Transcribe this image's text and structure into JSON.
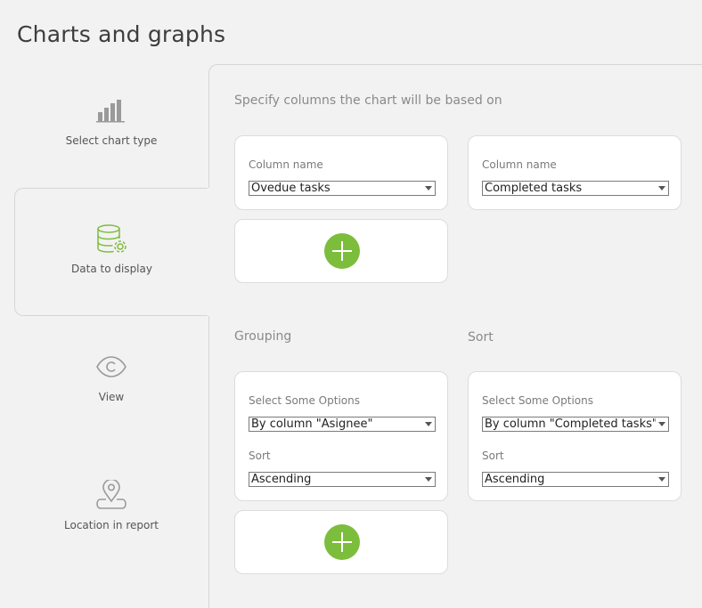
{
  "page": {
    "title": "Charts and graphs"
  },
  "colors": {
    "accent": "#7dbd3c",
    "background": "#f2f2f2"
  },
  "sidebar": {
    "steps": [
      {
        "label": "Select chart type",
        "icon": "bar-chart-icon",
        "active": false
      },
      {
        "label": "Data to display",
        "icon": "database-gear-icon",
        "active": true
      },
      {
        "label": "View",
        "icon": "eye-icon",
        "active": false
      },
      {
        "label": "Location in report",
        "icon": "map-pin-icon",
        "active": false
      }
    ]
  },
  "columns": {
    "heading": "Specify columns the chart will be based on",
    "cards": [
      {
        "label": "Column name",
        "value": "Ovedue tasks"
      },
      {
        "label": "Column name",
        "value": "Completed tasks"
      }
    ]
  },
  "grouping": {
    "heading": "Grouping",
    "options_label": "Select Some Options",
    "option_value": "By column \"Asignee\"",
    "sort_label": "Sort",
    "sort_value": "Ascending"
  },
  "sort": {
    "heading": "Sort",
    "options_label": "Select Some Options",
    "option_value": "By column \"Completed tasks\" by",
    "sort_label": "Sort",
    "sort_value": "Ascending"
  }
}
